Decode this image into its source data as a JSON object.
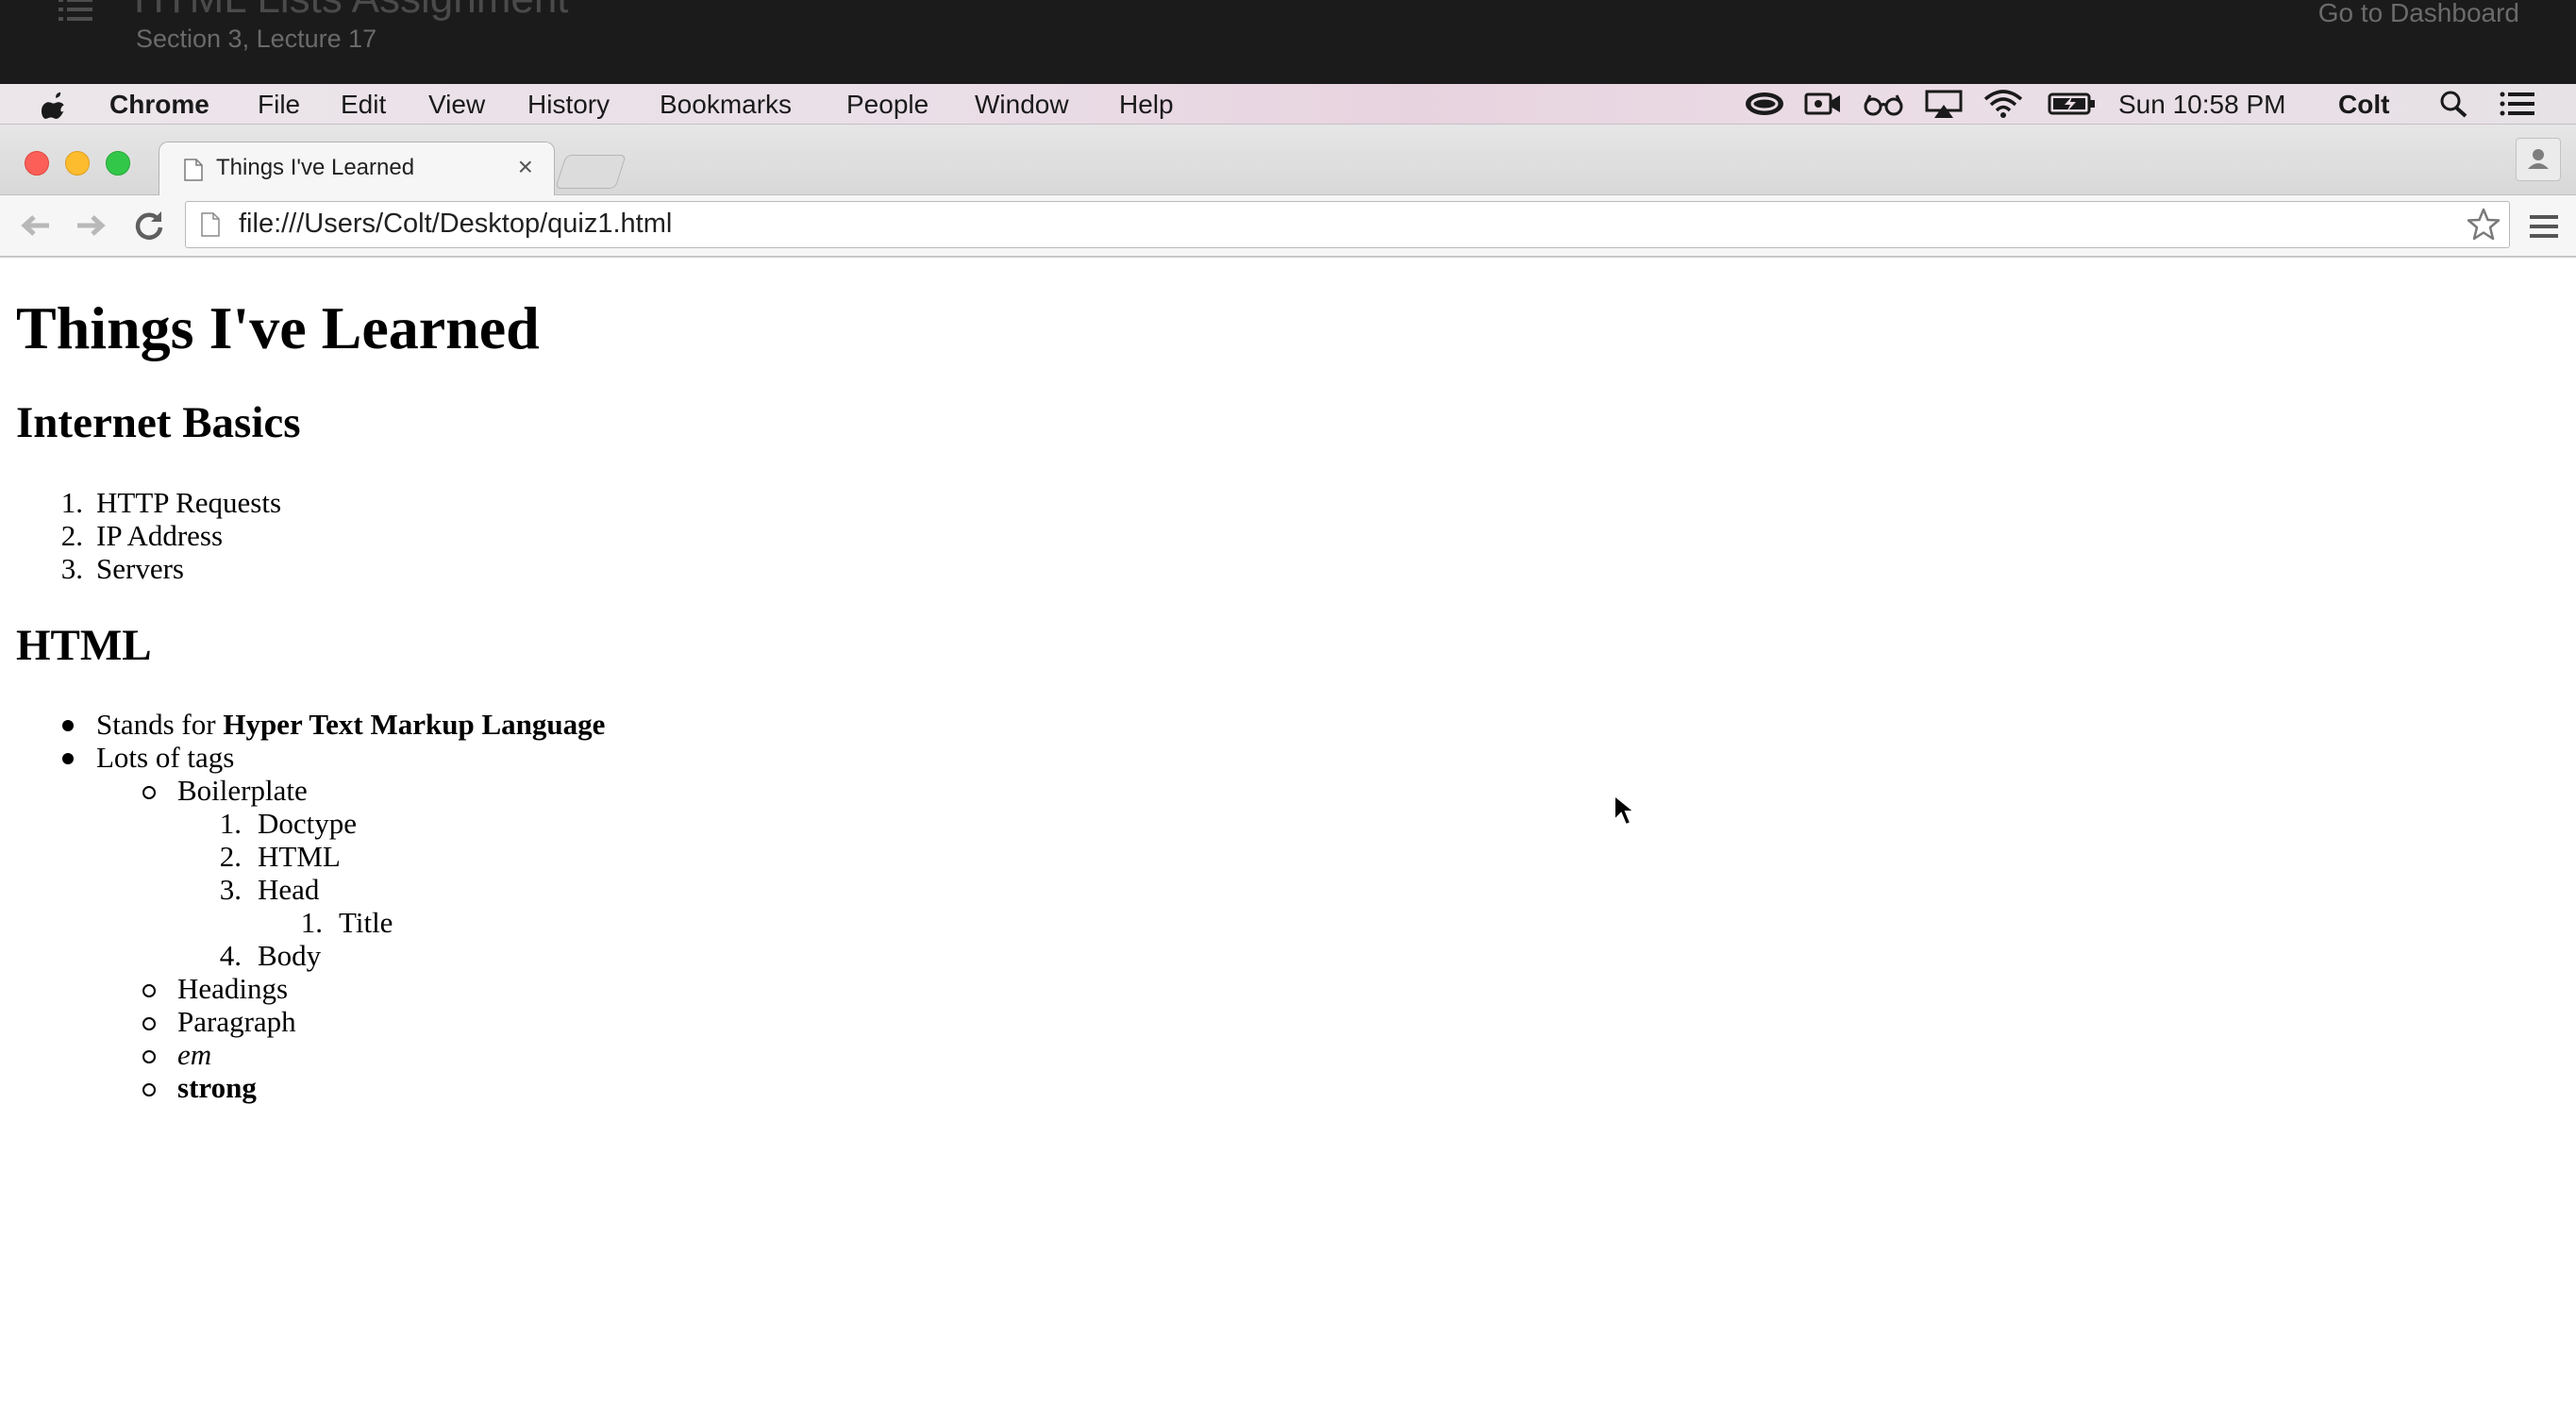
{
  "course": {
    "title": "HTML Lists Assignment",
    "subtitle": "Section 3, Lecture 17",
    "dashboard_link": "Go to Dashboard"
  },
  "menubar": {
    "app_name": "Chrome",
    "items": [
      "File",
      "Edit",
      "View",
      "History",
      "Bookmarks",
      "People",
      "Window",
      "Help"
    ],
    "clock": "Sun 10:58 PM",
    "user": "Colt",
    "status_icons": [
      "creative-cloud-icon",
      "camera-icon",
      "glasses-icon",
      "airplay-icon",
      "wifi-icon",
      "battery-icon",
      "spotlight-icon",
      "notification-center-icon"
    ]
  },
  "browser": {
    "tab_title": "Things I've Learned",
    "tab_close": "×",
    "url": "file:///Users/Colt/Desktop/quiz1.html"
  },
  "page": {
    "title": "Things I've Learned",
    "section1": {
      "heading": "Internet Basics",
      "items": [
        "HTTP Requests",
        "IP Address",
        "Servers"
      ]
    },
    "section2": {
      "heading": "HTML",
      "item1_prefix": "Stands for ",
      "item1_bold": "Hyper Text Markup Language",
      "item2": "Lots of tags",
      "boilerplate": "Boilerplate",
      "boilerplate_items": [
        "Doctype",
        "HTML",
        "Head",
        "Body"
      ],
      "head_items": [
        "Title"
      ],
      "tags": [
        "Headings",
        "Paragraph"
      ],
      "em": "em",
      "strong": "strong"
    }
  },
  "colors": {
    "close": "#fc5f57",
    "minimize": "#fdbc2e",
    "maximize": "#33c749",
    "overlay_bg": "#1b1b1b"
  }
}
